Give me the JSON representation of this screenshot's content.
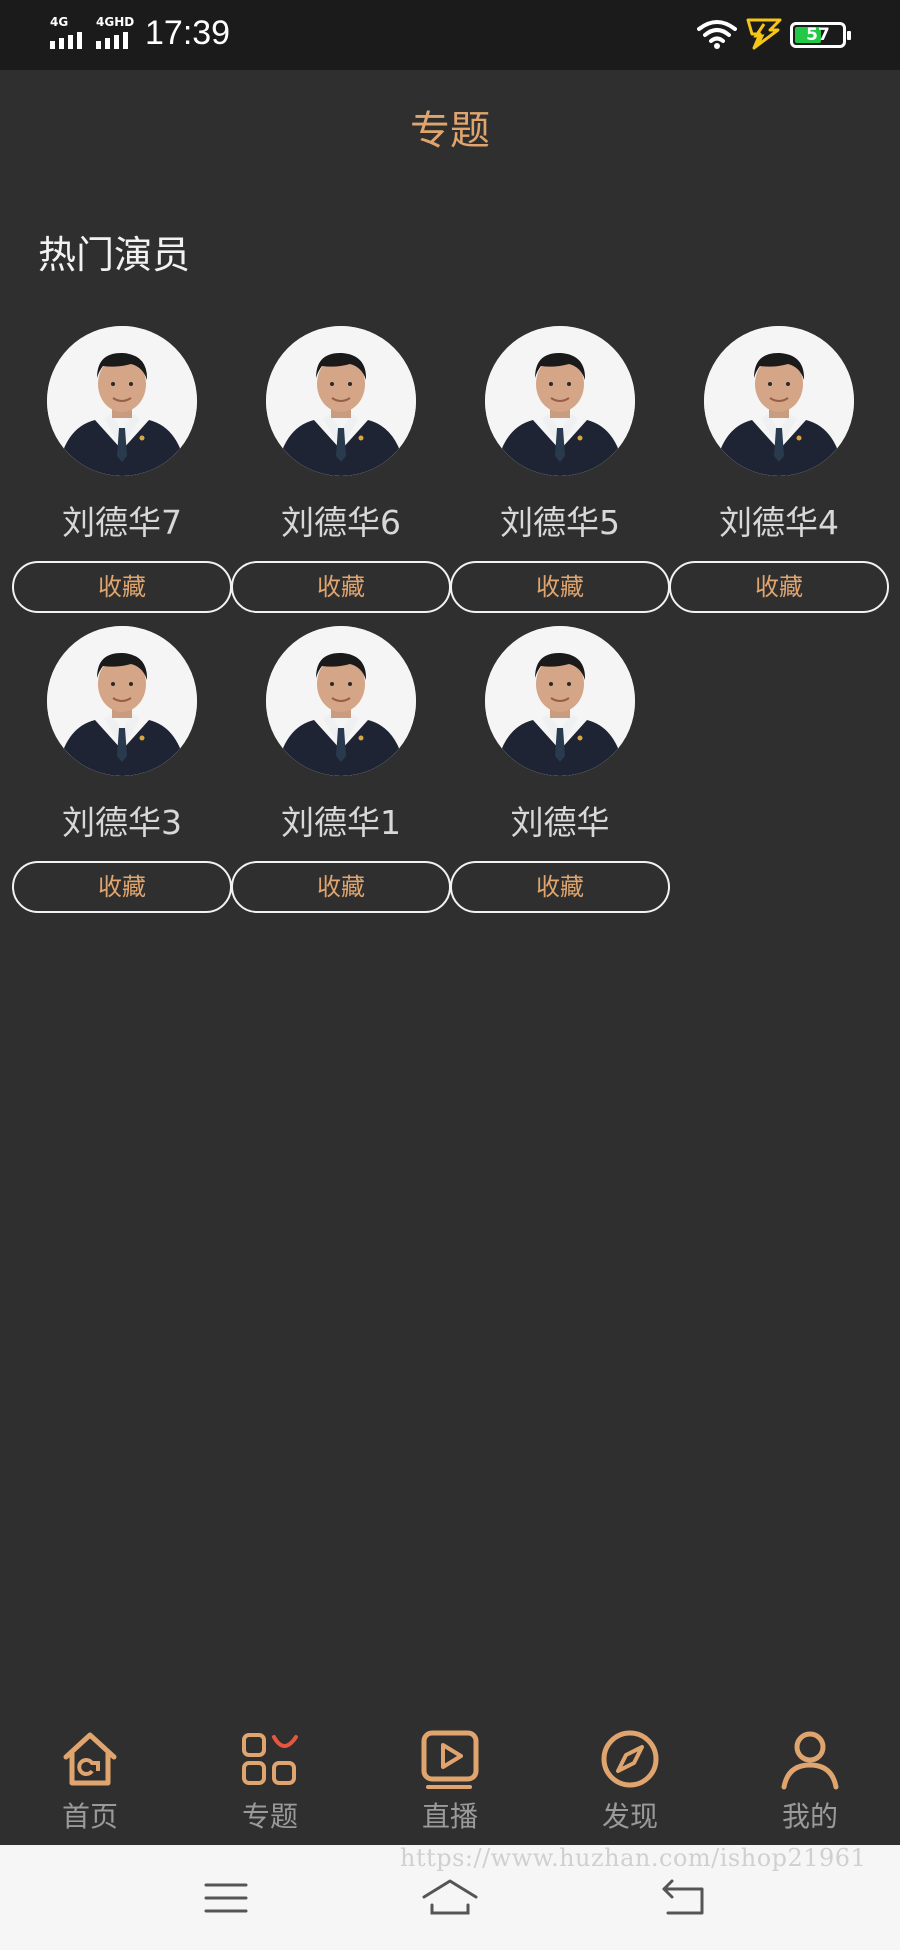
{
  "status_bar": {
    "signal1_label": "4G",
    "signal2_label": "4GHD",
    "time": "17:39",
    "battery_level": "57",
    "battery_fraction": 0.57
  },
  "header": {
    "title": "专题"
  },
  "section": {
    "title": "热门演员"
  },
  "favorite_label": "收藏",
  "actors": [
    {
      "name": "刘德华7"
    },
    {
      "name": "刘德华6"
    },
    {
      "name": "刘德华5"
    },
    {
      "name": "刘德华4"
    },
    {
      "name": "刘德华3"
    },
    {
      "name": "刘德华1"
    },
    {
      "name": "刘德华"
    }
  ],
  "tabbar": {
    "items": [
      {
        "label": "首页",
        "icon": "home-icon"
      },
      {
        "label": "专题",
        "icon": "topics-icon"
      },
      {
        "label": "直播",
        "icon": "live-play-icon"
      },
      {
        "label": "发现",
        "icon": "compass-icon"
      },
      {
        "label": "我的",
        "icon": "user-icon"
      }
    ]
  },
  "system_nav": {
    "icons": [
      "menu-icon",
      "home-outline-icon",
      "back-icon"
    ]
  },
  "watermark": "https://www.huzhan.com/ishop21961",
  "colors": {
    "accent": "#e0a56e",
    "background": "#2f2f2f",
    "statusbar": "#1b1b1b",
    "battery": "#23c847",
    "topics_highlight": "#e8553e"
  }
}
